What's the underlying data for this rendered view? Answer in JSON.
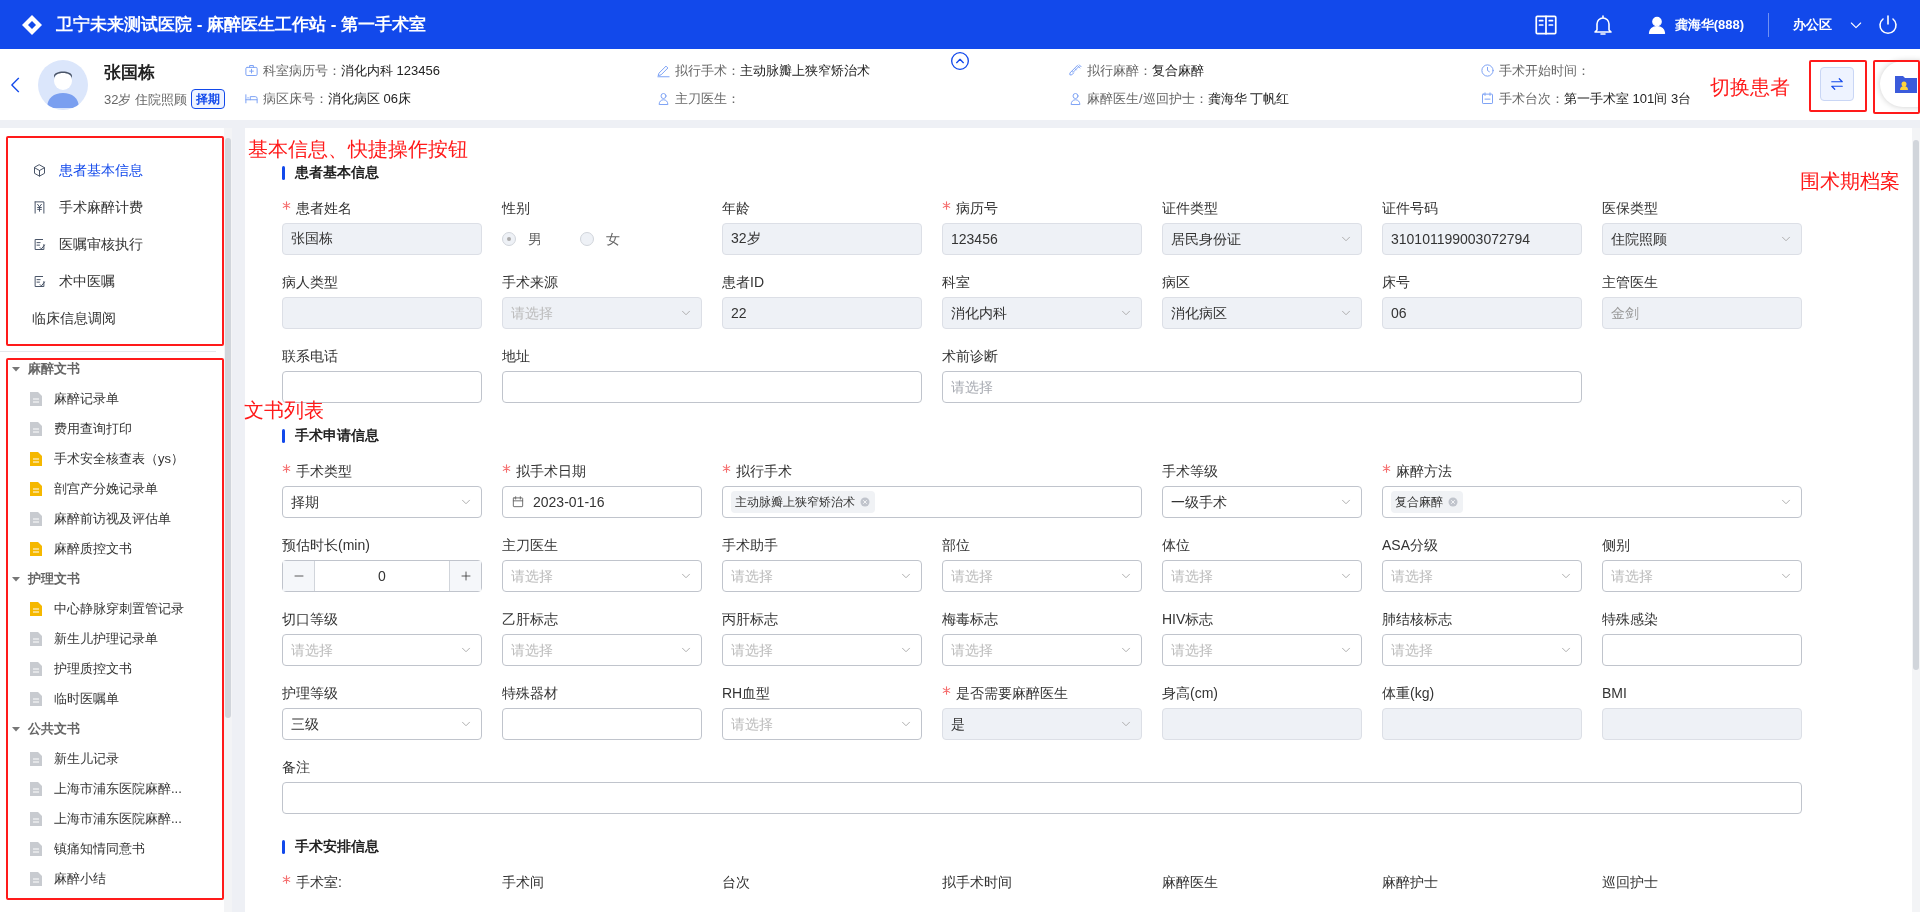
{
  "header": {
    "title": "卫宁未来测试医院 - 麻醉医生工作站 - 第一手术室",
    "user": "龚海华(888)",
    "area": "办公区"
  },
  "patient": {
    "name": "张国栋",
    "age": "32岁",
    "insurance": "住院照顾",
    "badge": "择期",
    "info": [
      {
        "label": "科室病历号：",
        "value": "消化内科 123456"
      },
      {
        "label": "拟行手术：",
        "value": "主动脉瓣上狭窄矫治术"
      },
      {
        "label": "拟行麻醉：",
        "value": "复合麻醉"
      },
      {
        "label": "手术开始时间："
      },
      {
        "label": "病区床号：",
        "value": "消化病区 06床"
      },
      {
        "label": "主刀医生："
      },
      {
        "label": "麻醉医生/巡回护士：",
        "value": "龚海华 丁帆红"
      },
      {
        "label": "手术台次：",
        "value": "第一手术室 101间 3台"
      }
    ]
  },
  "quick_menu": [
    {
      "label": "患者基本信息",
      "selected": true
    },
    {
      "label": "手术麻醉计费",
      "selected": false
    },
    {
      "label": "医嘱审核执行",
      "selected": false
    },
    {
      "label": "术中医嘱",
      "selected": false
    },
    {
      "label": "临床信息调阅",
      "selected": false
    }
  ],
  "documents": [
    {
      "label": "麻醉文书",
      "expanded": true,
      "children": [
        {
          "label": "麻醉记录单",
          "color": "#c8cbd0"
        },
        {
          "label": "费用查询打印",
          "color": "#c8cbd0"
        },
        {
          "label": "手术安全核查表（ys）",
          "color": "#f5b800"
        },
        {
          "label": "剖宫产分娩记录单",
          "color": "#f5b800"
        },
        {
          "label": "麻醉前访视及评估单",
          "color": "#c8cbd0"
        },
        {
          "label": "麻醉质控文书",
          "color": "#f5b800"
        }
      ]
    },
    {
      "label": "护理文书",
      "expanded": true,
      "children": [
        {
          "label": "中心静脉穿刺置管记录",
          "color": "#f5b800"
        },
        {
          "label": "新生儿护理记录单",
          "color": "#c8cbd0"
        },
        {
          "label": "护理质控文书",
          "color": "#c8cbd0"
        },
        {
          "label": "临时医嘱单",
          "color": "#c8cbd0"
        }
      ]
    },
    {
      "label": "公共文书",
      "expanded": true,
      "children": [
        {
          "label": "新生儿记录",
          "color": "#c8cbd0"
        },
        {
          "label": "上海市浦东医院麻醉...",
          "color": "#c8cbd0"
        },
        {
          "label": "上海市浦东医院麻醉...",
          "color": "#c8cbd0"
        },
        {
          "label": "镇痛知情同意书",
          "color": "#c8cbd0"
        },
        {
          "label": "麻醉小结",
          "color": "#c8cbd0"
        }
      ]
    }
  ],
  "sections": [
    {
      "title": "患者基本信息",
      "fields": [
        {
          "label": "患者姓名",
          "required": true,
          "kind": "input",
          "value": "张国栋",
          "disabled": true
        },
        {
          "label": "性别",
          "required": false,
          "kind": "radio",
          "disabled": true,
          "options": [
            {
              "label": "男",
              "selected": true
            },
            {
              "label": "女",
              "selected": false
            }
          ]
        },
        {
          "label": "年龄",
          "required": false,
          "kind": "input",
          "value": "32岁",
          "disabled": true
        },
        {
          "label": "病历号",
          "required": true,
          "kind": "input",
          "value": "123456",
          "disabled": true
        },
        {
          "label": "证件类型",
          "required": false,
          "kind": "select",
          "value": "居民身份证",
          "disabled": true
        },
        {
          "label": "证件号码",
          "required": false,
          "kind": "input",
          "value": "310101199003072794",
          "disabled": true
        },
        {
          "label": "医保类型",
          "required": false,
          "kind": "select",
          "value": "住院照顾",
          "disabled": true
        },
        {
          "label": "病人类型",
          "required": false,
          "kind": "input",
          "disabled": true
        },
        {
          "label": "手术来源",
          "required": false,
          "kind": "select",
          "placeholder": "请选择",
          "disabled": true
        },
        {
          "label": "患者ID",
          "required": false,
          "kind": "input",
          "value": "22",
          "disabled": true
        },
        {
          "label": "科室",
          "required": false,
          "kind": "select",
          "value": "消化内科",
          "disabled": true
        },
        {
          "label": "病区",
          "required": false,
          "kind": "select",
          "value": "消化病区",
          "disabled": true
        },
        {
          "label": "床号",
          "required": false,
          "kind": "input",
          "value": "06",
          "disabled": true
        },
        {
          "label": "主管医生",
          "required": false,
          "kind": "input",
          "placeholder": "金剑",
          "disabled": true
        },
        {
          "label": "联系电话",
          "required": false,
          "kind": "input",
          "disabled": false
        },
        {
          "label": "地址",
          "required": false,
          "kind": "input",
          "disabled": false
        },
        {
          "label": "术前诊断",
          "required": false,
          "kind": "input",
          "placeholder": "请选择",
          "disabled": false
        }
      ]
    },
    {
      "title": "手术申请信息",
      "fields": [
        {
          "label": "手术类型",
          "required": true,
          "kind": "select",
          "value": "择期",
          "disabled": false
        },
        {
          "label": "拟手术日期",
          "required": true,
          "kind": "date",
          "value": "2023-01-16",
          "disabled": false
        },
        {
          "label": "拟行手术",
          "required": true,
          "kind": "tags",
          "tags": [
            "主动脉瓣上狭窄矫治术"
          ],
          "disabled": false
        },
        {
          "label": "手术等级",
          "required": false,
          "kind": "select",
          "value": "一级手术",
          "disabled": false
        },
        {
          "label": "麻醉方法",
          "required": true,
          "kind": "tag-select",
          "tags": [
            "复合麻醉"
          ],
          "disabled": false
        },
        {
          "label": "预估时长(min)",
          "required": false,
          "kind": "stepper",
          "value": "0",
          "disabled": false
        },
        {
          "label": "主刀医生",
          "required": false,
          "kind": "select",
          "placeholder": "请选择",
          "disabled": false
        },
        {
          "label": "手术助手",
          "required": false,
          "kind": "select",
          "placeholder": "请选择",
          "disabled": false
        },
        {
          "label": "部位",
          "required": false,
          "kind": "select",
          "placeholder": "请选择",
          "disabled": false
        },
        {
          "label": "体位",
          "required": false,
          "kind": "select",
          "placeholder": "请选择",
          "disabled": false
        },
        {
          "label": "ASA分级",
          "required": false,
          "kind": "select",
          "placeholder": "请选择",
          "disabled": false
        },
        {
          "label": "侧别",
          "required": false,
          "kind": "select",
          "placeholder": "请选择",
          "disabled": false
        },
        {
          "label": "切口等级",
          "required": false,
          "kind": "select",
          "placeholder": "请选择",
          "disabled": false
        },
        {
          "label": "乙肝标志",
          "required": false,
          "kind": "select",
          "placeholder": "请选择",
          "disabled": false
        },
        {
          "label": "丙肝标志",
          "required": false,
          "kind": "select",
          "placeholder": "请选择",
          "disabled": false
        },
        {
          "label": "梅毒标志",
          "required": false,
          "kind": "select",
          "placeholder": "请选择",
          "disabled": false
        },
        {
          "label": "HIV标志",
          "required": false,
          "kind": "select",
          "placeholder": "请选择",
          "disabled": false
        },
        {
          "label": "肺结核标志",
          "required": false,
          "kind": "select",
          "placeholder": "请选择",
          "disabled": false
        },
        {
          "label": "特殊感染",
          "required": false,
          "kind": "input",
          "disabled": false
        },
        {
          "label": "护理等级",
          "required": false,
          "kind": "select",
          "value": "三级",
          "disabled": false
        },
        {
          "label": "特殊器材",
          "required": false,
          "kind": "input",
          "disabled": false
        },
        {
          "label": "RH血型",
          "required": false,
          "kind": "select",
          "placeholder": "请选择",
          "disabled": false
        },
        {
          "label": "是否需要麻醉医生",
          "required": true,
          "kind": "select",
          "value": "是",
          "disabled": true
        },
        {
          "label": "身高(cm)",
          "required": false,
          "kind": "input",
          "disabled": true
        },
        {
          "label": "体重(kg)",
          "required": false,
          "kind": "input",
          "disabled": true
        },
        {
          "label": "BMI",
          "required": false,
          "kind": "input",
          "disabled": true
        },
        {
          "label": "备注",
          "required": false,
          "kind": "input",
          "disabled": false
        }
      ]
    },
    {
      "title": "手术安排信息",
      "fields": [
        {
          "label": "手术室:",
          "required": true,
          "kind": "none"
        },
        {
          "label": "手术间",
          "required": false,
          "kind": "none"
        },
        {
          "label": "台次",
          "required": false,
          "kind": "none"
        },
        {
          "label": "拟手术时间",
          "required": false,
          "kind": "none"
        },
        {
          "label": "麻醉医生",
          "required": false,
          "kind": "none"
        },
        {
          "label": "麻醉护士",
          "required": false,
          "kind": "none"
        },
        {
          "label": "巡回护士",
          "required": false,
          "kind": "none"
        }
      ]
    }
  ],
  "annotations": [
    {
      "text": "基本信息、快捷操作按钮"
    },
    {
      "text": "文书列表"
    },
    {
      "text": "切换患者"
    },
    {
      "text": "围术期档案"
    }
  ]
}
